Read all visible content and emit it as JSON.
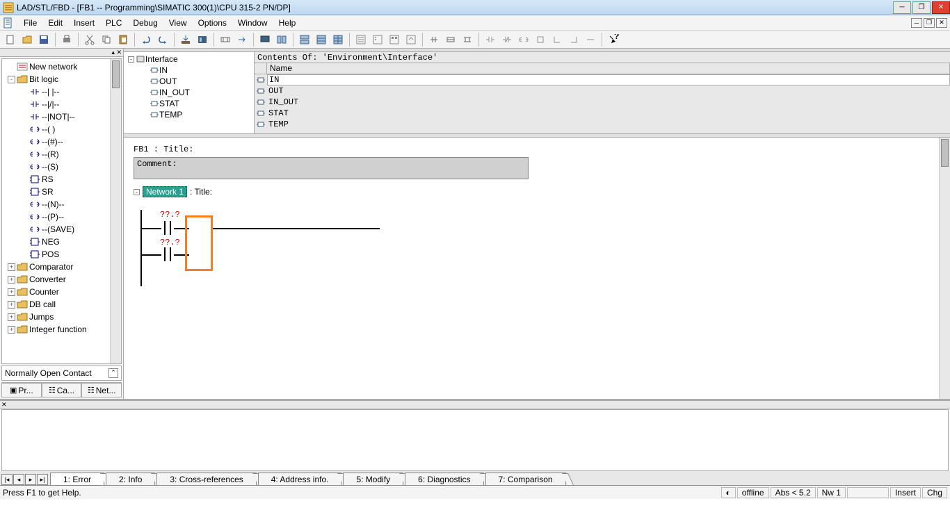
{
  "title": "LAD/STL/FBD  - [FB1 -- Programming\\SIMATIC 300(1)\\CPU 315-2 PN/DP]",
  "menu": [
    "File",
    "Edit",
    "Insert",
    "PLC",
    "Debug",
    "View",
    "Options",
    "Window",
    "Help"
  ],
  "left": {
    "nodes": [
      {
        "indent": 0,
        "tw": "",
        "icon": "net",
        "label": "New network"
      },
      {
        "indent": 0,
        "tw": "-",
        "icon": "folder",
        "label": "Bit logic"
      },
      {
        "indent": 1,
        "tw": "",
        "icon": "contact",
        "label": "--| |--"
      },
      {
        "indent": 1,
        "tw": "",
        "icon": "contact",
        "label": "--|/|--"
      },
      {
        "indent": 1,
        "tw": "",
        "icon": "contact",
        "label": "--|NOT|--"
      },
      {
        "indent": 1,
        "tw": "",
        "icon": "coil",
        "label": "--( )"
      },
      {
        "indent": 1,
        "tw": "",
        "icon": "coil",
        "label": "--(#)--"
      },
      {
        "indent": 1,
        "tw": "",
        "icon": "coil",
        "label": "--(R)"
      },
      {
        "indent": 1,
        "tw": "",
        "icon": "coil",
        "label": "--(S)"
      },
      {
        "indent": 1,
        "tw": "",
        "icon": "block",
        "label": "RS"
      },
      {
        "indent": 1,
        "tw": "",
        "icon": "block",
        "label": "SR"
      },
      {
        "indent": 1,
        "tw": "",
        "icon": "coil",
        "label": "--(N)--"
      },
      {
        "indent": 1,
        "tw": "",
        "icon": "coil",
        "label": "--(P)--"
      },
      {
        "indent": 1,
        "tw": "",
        "icon": "coil",
        "label": "--(SAVE)"
      },
      {
        "indent": 1,
        "tw": "",
        "icon": "block",
        "label": "NEG"
      },
      {
        "indent": 1,
        "tw": "",
        "icon": "block",
        "label": "POS"
      },
      {
        "indent": 0,
        "tw": "+",
        "icon": "folder",
        "label": "Comparator"
      },
      {
        "indent": 0,
        "tw": "+",
        "icon": "folder",
        "label": "Converter"
      },
      {
        "indent": 0,
        "tw": "+",
        "icon": "folder",
        "label": "Counter"
      },
      {
        "indent": 0,
        "tw": "+",
        "icon": "folder",
        "label": "DB call"
      },
      {
        "indent": 0,
        "tw": "+",
        "icon": "folder",
        "label": "Jumps"
      },
      {
        "indent": 0,
        "tw": "+",
        "icon": "folder",
        "label": "Integer function"
      }
    ],
    "status": "Normally Open Contact",
    "tabs": [
      "Pr...",
      "Ca...",
      "Net..."
    ]
  },
  "iface": {
    "contentsOf": "Contents Of: 'Environment\\Interface'",
    "tree": [
      {
        "indent": 0,
        "tw": "-",
        "label": "Interface"
      },
      {
        "indent": 1,
        "tw": "",
        "label": "IN"
      },
      {
        "indent": 1,
        "tw": "",
        "label": "OUT"
      },
      {
        "indent": 1,
        "tw": "",
        "label": "IN_OUT"
      },
      {
        "indent": 1,
        "tw": "",
        "label": "STAT"
      },
      {
        "indent": 1,
        "tw": "",
        "label": "TEMP"
      }
    ],
    "colName": "Name",
    "rows": [
      "IN",
      "OUT",
      "IN_OUT",
      "STAT",
      "TEMP"
    ]
  },
  "editor": {
    "fbTitle": "FB1 : Title:",
    "comment": "Comment:",
    "netLabel": "Network 1",
    "netTitle": ": Title:",
    "q1": "??.?",
    "q2": "??.?"
  },
  "bottomTabs": [
    "1: Error",
    "2: Info",
    "3: Cross-references",
    "4: Address info.",
    "5: Modify",
    "6: Diagnostics",
    "7: Comparison"
  ],
  "status": {
    "help": "Press F1 to get Help.",
    "offline": "offline",
    "abs": "Abs < 5.2",
    "nw": "Nw 1",
    "ins": "Insert",
    "chg": "Chg"
  }
}
